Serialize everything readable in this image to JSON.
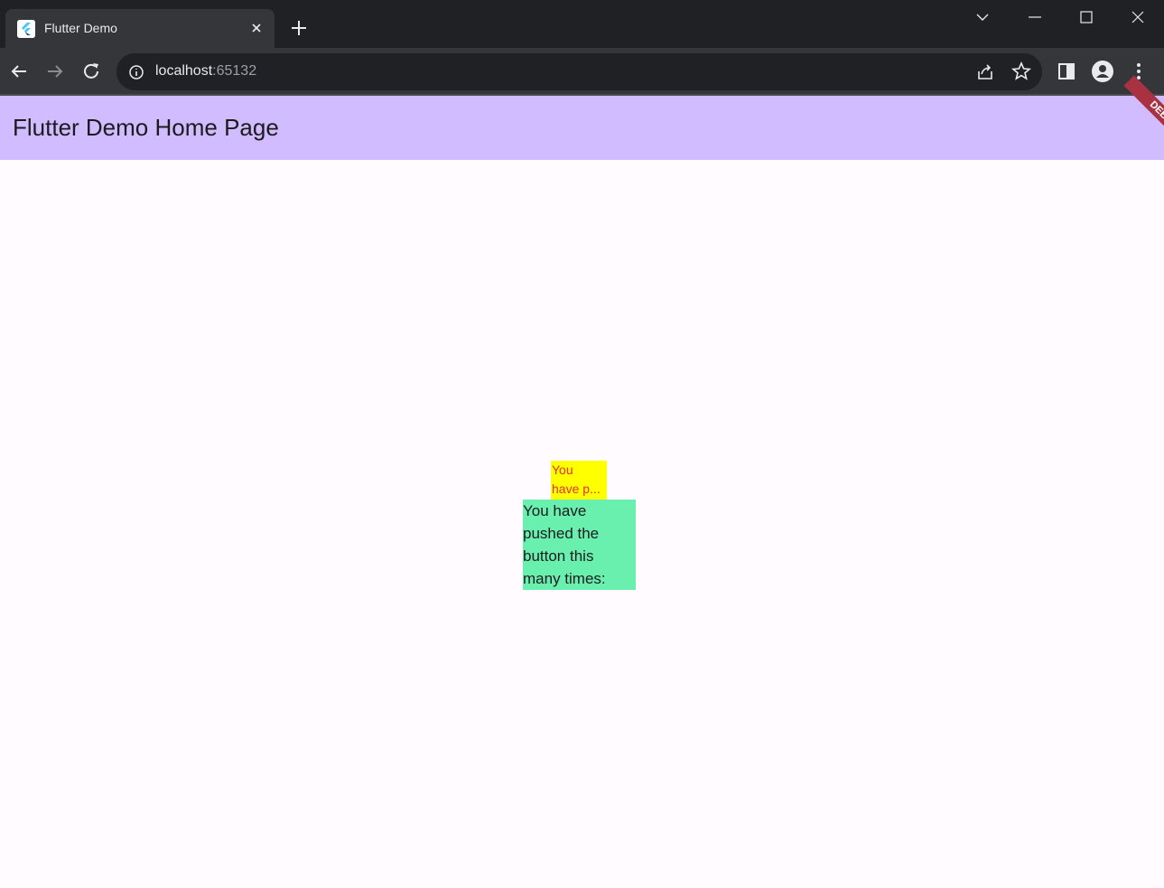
{
  "browser": {
    "tab": {
      "title": "Flutter Demo",
      "close_icon": "close-icon",
      "favicon": "flutter-logo-icon"
    },
    "new_tab_icon": "plus-icon",
    "window_controls": [
      "chevron-down-icon",
      "minimize-icon",
      "maximize-icon",
      "close-icon"
    ],
    "nav": [
      "back-icon",
      "forward-icon",
      "reload-icon"
    ],
    "address": {
      "host": "localhost",
      "port": ":65132",
      "site_info_icon": "info-icon"
    },
    "toolbar_icons": [
      "share-icon",
      "star-icon",
      "side-panel-icon",
      "profile-icon",
      "more-vertical-icon"
    ]
  },
  "app": {
    "appbar_title": "Flutter Demo Home Page",
    "debug_banner": "DEBUG",
    "yellow_text": {
      "line1": "You",
      "line2": "have p..."
    },
    "green_text": {
      "line1": "You have",
      "line2": "pushed the",
      "line3": "button this",
      "line4": "many times:"
    }
  },
  "colors": {
    "appbar": "#d0bcff",
    "background": "#fffbfe",
    "yellow_box": "#ffff00",
    "yellow_text": "#e0332e",
    "green_box": "#69f0ae",
    "debug_banner": "#a83242"
  }
}
